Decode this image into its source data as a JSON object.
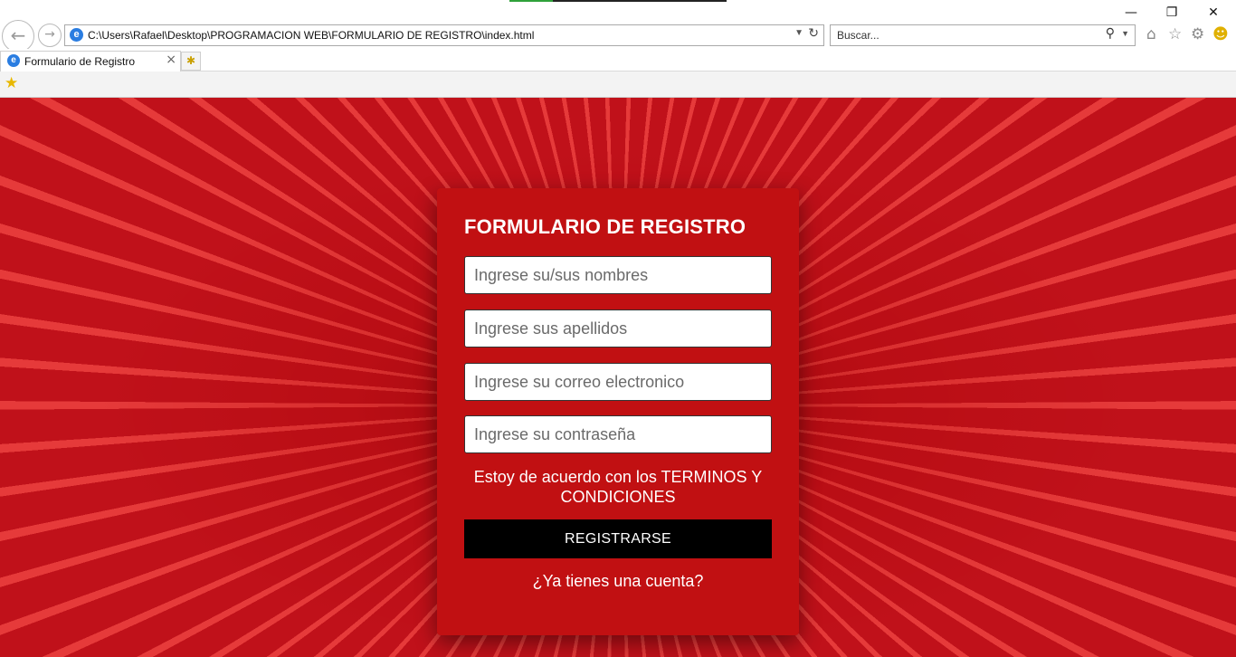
{
  "browser": {
    "address_url": "C:\\Users\\Rafael\\Desktop\\PROGRAMACION WEB\\FORMULARIO DE REGISTRO\\index.html",
    "search_placeholder": "Buscar...",
    "tab_title": "Formulario de Registro",
    "icons": [
      "back-icon",
      "forward-icon",
      "ie-logo-icon",
      "dropdown-icon",
      "refresh-icon",
      "search-icon",
      "home-icon",
      "favorites-star-icon",
      "settings-gear-icon",
      "smiley-icon",
      "close-icon",
      "new-tab-icon",
      "add-favorite-icon",
      "minimize-icon",
      "restore-icon"
    ]
  },
  "form": {
    "title": "FORMULARIO DE REGISTRO",
    "fields": [
      {
        "placeholder": "Ingrese su/sus nombres"
      },
      {
        "placeholder": "Ingrese sus apellidos"
      },
      {
        "placeholder": "Ingrese su correo electronico"
      },
      {
        "placeholder": "Ingrese su contraseña"
      }
    ],
    "terms_text": "Estoy de acuerdo con los TERMINOS Y CONDICIONES",
    "submit_label": "REGISTRARSE",
    "login_link": "¿Ya tienes una cuenta?"
  },
  "colors": {
    "card_background": "#c11012",
    "page_background": "#c0111a",
    "button_background": "#000000",
    "text_color": "#ffffff"
  }
}
